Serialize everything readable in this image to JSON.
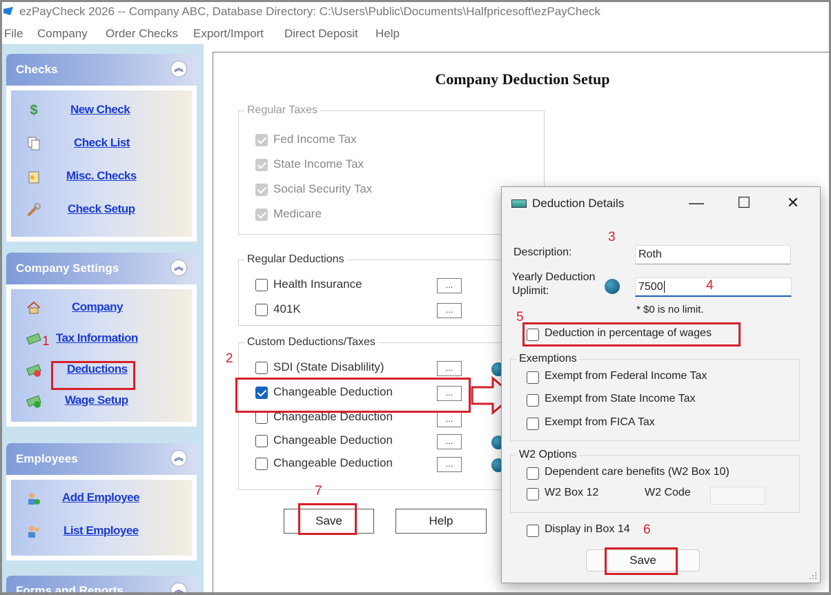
{
  "window": {
    "title": "ezPayCheck 2026 -- Company ABC, Database Directory: C:\\Users\\Public\\Documents\\Halfpricesoft\\ezPayCheck"
  },
  "menu": [
    "File",
    "Company",
    "Order Checks",
    "Export/Import",
    "Direct Deposit",
    "Help"
  ],
  "sidebar": {
    "checks": {
      "title": "Checks",
      "items": [
        "New Check",
        "Check List",
        "Misc. Checks",
        "Check Setup"
      ]
    },
    "company_settings": {
      "title": "Company Settings",
      "items": [
        "Company",
        "Tax Information",
        "Deductions",
        "Wage Setup"
      ]
    },
    "employees": {
      "title": "Employees",
      "items": [
        "Add Employee",
        "List Employee"
      ]
    },
    "forms_reports": {
      "title": "Forms and Reports"
    }
  },
  "main": {
    "title": "Company Deduction Setup",
    "regular_taxes": {
      "legend": "Regular Taxes",
      "items": [
        "Fed Income Tax",
        "State Income Tax",
        "Social Security Tax",
        "Medicare"
      ]
    },
    "regular_deductions": {
      "legend": "Regular Deductions",
      "items": [
        "Health Insurance",
        "401K"
      ],
      "dots": "..."
    },
    "custom_deductions": {
      "legend": "Custom Deductions/Taxes",
      "items": [
        "SDI (State Disablility)",
        "Changeable Deduction",
        "Changeable Deduction",
        "Changeable Deduction",
        "Changeable Deduction"
      ],
      "checked_index": 1
    },
    "save_label": "Save",
    "help_label": "Help"
  },
  "dialog": {
    "title": "Deduction Details",
    "description_label": "Description:",
    "description_value": "Roth",
    "uplimit_label_1": "Yearly Deduction",
    "uplimit_label_2": "Uplimit:",
    "uplimit_value": "7500",
    "no_limit_note": "* $0 is no limit.",
    "percentage_label": "Deduction in percentage of wages",
    "exemptions": {
      "legend": "Exemptions",
      "items": [
        "Exempt from Federal Income Tax",
        "Exempt from State Income Tax",
        "Exempt from FICA Tax"
      ]
    },
    "w2_options": {
      "legend": "W2 Options",
      "dependent_care": "Dependent care benefits (W2 Box 10)",
      "w2_box12": "W2 Box 12",
      "w2_code_label": "W2 Code"
    },
    "display_box14": "Display in Box 14",
    "save_label": "Save"
  },
  "annotations": [
    "1",
    "2",
    "3",
    "4",
    "5",
    "6",
    "7"
  ],
  "colors": {
    "annotation_red": "#d6202a",
    "link_blue": "#1a3bd1",
    "sidebar_bg": "#c9e2ef",
    "checkbox_checked": "#1565c0"
  }
}
